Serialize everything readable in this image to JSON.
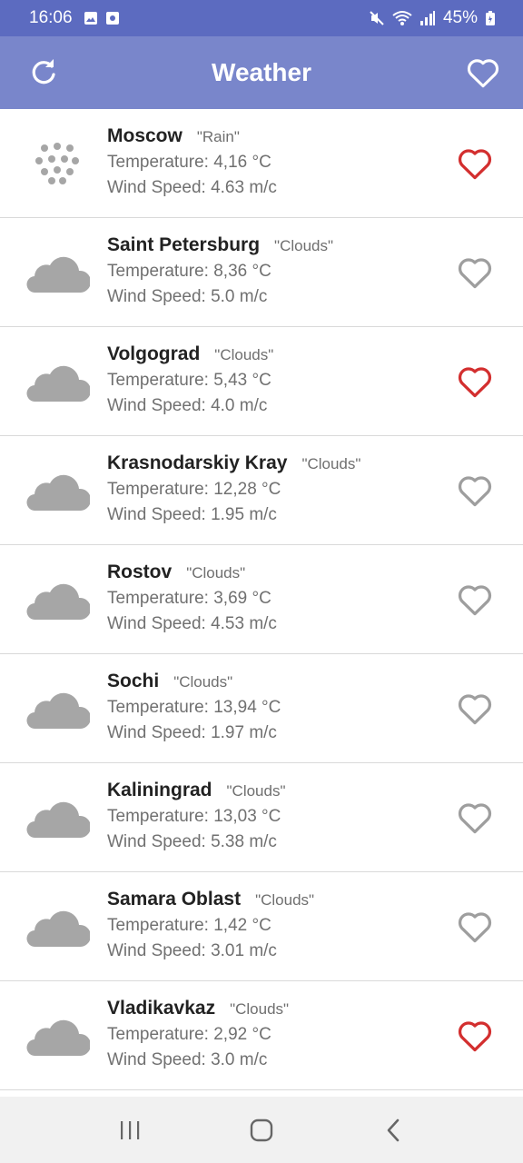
{
  "status_bar": {
    "time": "16:06",
    "battery": "45%"
  },
  "app_bar": {
    "title": "Weather"
  },
  "colors": {
    "header": "#7986cb",
    "status": "#5c6bc0",
    "favorite_active": "#d32f2f",
    "favorite_inactive": "#9e9e9e",
    "icon_gray": "#a6a6a6"
  },
  "cities": [
    {
      "name": "Moscow",
      "condition": "\"Rain\"",
      "temperature": "Temperature: 4,16 °C",
      "wind": "Wind Speed: 4.63 m/c",
      "icon": "rain-icon",
      "favorite": true
    },
    {
      "name": "Saint Petersburg",
      "condition": "\"Clouds\"",
      "temperature": "Temperature: 8,36 °C",
      "wind": "Wind Speed: 5.0 m/c",
      "icon": "cloud-icon",
      "favorite": false
    },
    {
      "name": "Volgograd",
      "condition": "\"Clouds\"",
      "temperature": "Temperature: 5,43 °C",
      "wind": "Wind Speed: 4.0 m/c",
      "icon": "cloud-icon",
      "favorite": true
    },
    {
      "name": "Krasnodarskiy Kray",
      "condition": "\"Clouds\"",
      "temperature": "Temperature: 12,28 °C",
      "wind": "Wind Speed: 1.95 m/c",
      "icon": "cloud-icon",
      "favorite": false
    },
    {
      "name": "Rostov",
      "condition": "\"Clouds\"",
      "temperature": "Temperature: 3,69 °C",
      "wind": "Wind Speed: 4.53 m/c",
      "icon": "cloud-icon",
      "favorite": false
    },
    {
      "name": "Sochi",
      "condition": "\"Clouds\"",
      "temperature": "Temperature: 13,94 °C",
      "wind": "Wind Speed: 1.97 m/c",
      "icon": "cloud-icon",
      "favorite": false
    },
    {
      "name": "Kaliningrad",
      "condition": "\"Clouds\"",
      "temperature": "Temperature: 13,03 °C",
      "wind": "Wind Speed: 5.38 m/c",
      "icon": "cloud-icon",
      "favorite": false
    },
    {
      "name": "Samara Oblast",
      "condition": "\"Clouds\"",
      "temperature": "Temperature: 1,42 °C",
      "wind": "Wind Speed: 3.01 m/c",
      "icon": "cloud-icon",
      "favorite": false
    },
    {
      "name": "Vladikavkaz",
      "condition": "\"Clouds\"",
      "temperature": "Temperature: 2,92 °C",
      "wind": "Wind Speed: 3.0 m/c",
      "icon": "cloud-icon",
      "favorite": true
    }
  ],
  "nav": {
    "recents": "recents-icon",
    "home": "home-icon",
    "back": "back-icon"
  }
}
